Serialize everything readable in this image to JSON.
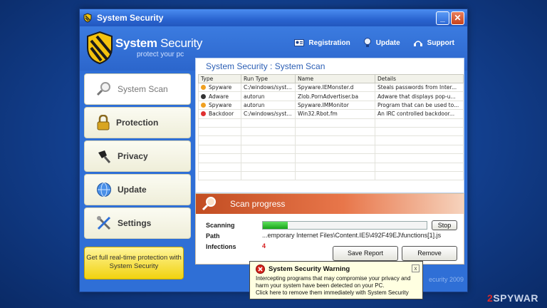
{
  "window": {
    "title": "System Security"
  },
  "header": {
    "logo_title_bold": "System",
    "logo_title_rest": " Security",
    "logo_sub": "protect your pc",
    "links": [
      {
        "label": "Registration",
        "icon": "id-card-icon"
      },
      {
        "label": "Update",
        "icon": "update-icon"
      },
      {
        "label": "Support",
        "icon": "support-icon"
      }
    ]
  },
  "sidebar": {
    "items": [
      {
        "label": "System Scan",
        "icon": "magnifier-icon",
        "active": true
      },
      {
        "label": "Protection",
        "icon": "lock-icon",
        "active": false
      },
      {
        "label": "Privacy",
        "icon": "privacy-icon",
        "active": false
      },
      {
        "label": "Update",
        "icon": "globe-icon",
        "active": false
      },
      {
        "label": "Settings",
        "icon": "tools-icon",
        "active": false
      }
    ],
    "promo": "Get full real-time protection with System Security"
  },
  "main": {
    "title": "System Security : System Scan",
    "columns": [
      "Type",
      "Run Type",
      "Name",
      "Details"
    ],
    "rows": [
      {
        "type": "Spyware",
        "run": "C:/windows/syst...",
        "name": "Spyware.IEMonster.d",
        "details": "Steals passwords from Inter...",
        "color": "#f0a020"
      },
      {
        "type": "Adware",
        "run": "autorun",
        "name": "Zlob.PornAdvertiser.ba",
        "details": "Adware that displays pop-u...",
        "color": "#333333"
      },
      {
        "type": "Spyware",
        "run": "autorun",
        "name": "Spyware.IMMonitor",
        "details": "Program that can be used to...",
        "color": "#f0a020"
      },
      {
        "type": "Backdoor",
        "run": "C:/windows/syst...",
        "name": "Win32.Rbot.fm",
        "details": "An IRC controlled backdoor...",
        "color": "#e03030"
      }
    ],
    "empty_rows": 7
  },
  "scan": {
    "heading": "Scan progress",
    "scanning_label": "Scanning",
    "path_label": "Path",
    "infections_label": "Infections",
    "progress": 0.15,
    "path_value": "...emporary Internet Files\\Content.IE5\\492F49EJ\\functions[1].js",
    "infections_value": "4",
    "stop_label": "Stop",
    "save_label": "Save Report",
    "remove_label": "Remove"
  },
  "footer": {
    "copyright": "ecurity 2009"
  },
  "popup": {
    "title": "System Security Warning",
    "body_1": "Intercepting programs that may compromise your privacy and",
    "body_2": "harm your system have been detected on your PC.",
    "body_3": "Click here to remove them immediately with System Security",
    "close": "x"
  },
  "watermark": {
    "num": "2",
    "text": "SPYWAR"
  }
}
